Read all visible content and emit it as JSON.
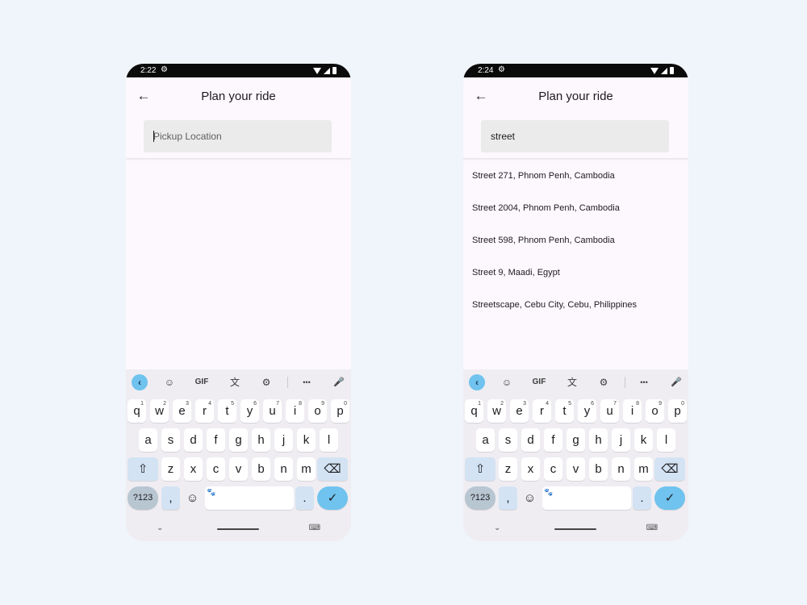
{
  "screens": [
    {
      "time": "2:22",
      "header": {
        "title": "Plan your ride",
        "back_icon": "←"
      },
      "search": {
        "value": "",
        "placeholder": "Pickup Location"
      },
      "results": []
    },
    {
      "time": "2:24",
      "header": {
        "title": "Plan your ride",
        "back_icon": "←"
      },
      "search": {
        "value": "street",
        "placeholder": "Pickup Location"
      },
      "results": [
        "Street 271, Phnom Penh, Cambodia",
        "Street 2004, Phnom Penh, Cambodia",
        "Street 598, Phnom Penh, Cambodia",
        "Street 9, Maadi, Egypt",
        "Streetscape, Cebu City, Cebu, Philippines"
      ]
    }
  ],
  "statusbar": {
    "gear_icon": "⚙"
  },
  "keyboard": {
    "toolbar": {
      "collapse": "‹",
      "sticker": "☺",
      "gif": "GIF",
      "translate": "文",
      "settings": "⚙",
      "more": "•••",
      "mic": "🎤"
    },
    "row1": [
      {
        "key": "q",
        "hint": "1"
      },
      {
        "key": "w",
        "hint": "2"
      },
      {
        "key": "e",
        "hint": "3"
      },
      {
        "key": "r",
        "hint": "4"
      },
      {
        "key": "t",
        "hint": "5"
      },
      {
        "key": "y",
        "hint": "6"
      },
      {
        "key": "u",
        "hint": "7"
      },
      {
        "key": "i",
        "hint": "8"
      },
      {
        "key": "o",
        "hint": "9"
      },
      {
        "key": "p",
        "hint": "0"
      }
    ],
    "row2": [
      "a",
      "s",
      "d",
      "f",
      "g",
      "h",
      "j",
      "k",
      "l"
    ],
    "row3": [
      "z",
      "x",
      "c",
      "v",
      "b",
      "n",
      "m"
    ],
    "shift": "⇧",
    "backspace": "⌫",
    "symbols": "?123",
    "comma": ",",
    "emoji": "☺",
    "space_icon": "🐾",
    "period": ".",
    "enter": "✓",
    "nav_chevron": "⌄",
    "nav_keyboard": "⌨"
  },
  "colors": {
    "background": "#eff5fa",
    "accent": "#6fc3ee",
    "keyboard_bg": "#efedf2",
    "search_bg": "#ebebeb"
  }
}
